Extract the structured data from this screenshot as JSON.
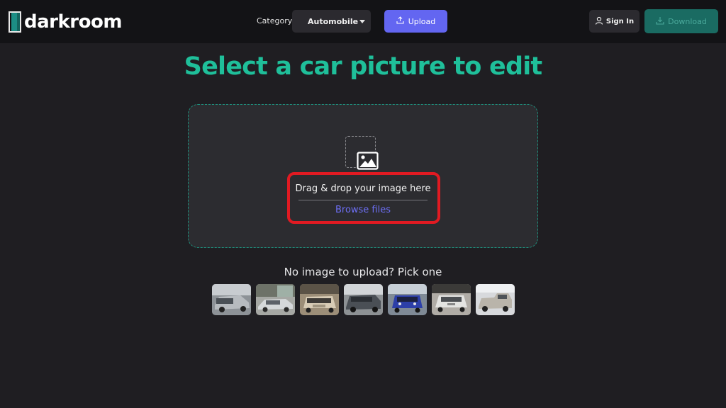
{
  "header": {
    "logo_text": "darkroom",
    "category_label": "Category:",
    "category_value": "Automobile",
    "upload_label": "Upload",
    "signin_label": "Sign In",
    "download_label": "Download"
  },
  "main": {
    "title": "Select a car picture to edit",
    "dropzone": {
      "drag_text": "Drag & drop your image here",
      "browse_label": "Browse files"
    },
    "samples_heading": "No image to upload? Pick one",
    "samples": [
      {
        "name": "sample-car-1"
      },
      {
        "name": "sample-car-2"
      },
      {
        "name": "sample-car-3"
      },
      {
        "name": "sample-car-4"
      },
      {
        "name": "sample-car-5"
      },
      {
        "name": "sample-car-6"
      },
      {
        "name": "sample-car-7"
      }
    ]
  },
  "icons": {
    "logo": "darkroom-logo-icon",
    "upload": "upload-icon",
    "signin": "user-icon",
    "download": "download-icon",
    "image": "image-icon",
    "caret": "chevron-down-icon"
  },
  "colors": {
    "accent_teal": "#1fbf9a",
    "accent_purple": "#6366f1",
    "highlight_red": "#e11a22",
    "background": "#1f1e22",
    "header": "#131316"
  }
}
